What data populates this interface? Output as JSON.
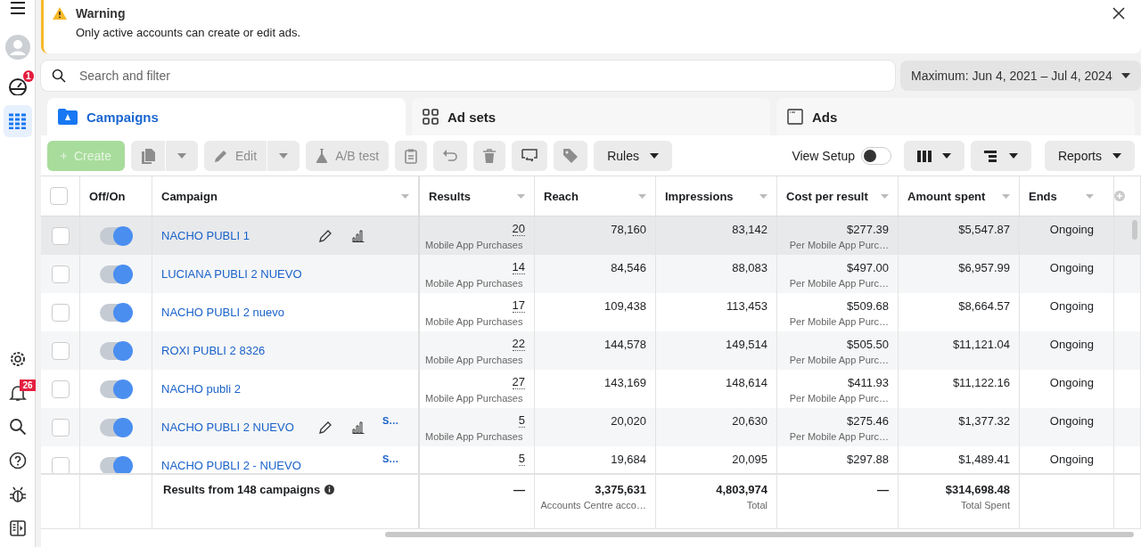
{
  "sidebar": {
    "items": [
      {
        "kind": "menu",
        "selected": false
      },
      {
        "kind": "profile",
        "selected": false
      },
      {
        "kind": "gauge",
        "selected": false,
        "badge": "1"
      },
      {
        "kind": "table",
        "selected": true
      }
    ],
    "bottom_items": [
      {
        "kind": "settings",
        "selected": false
      },
      {
        "kind": "bell",
        "selected": false,
        "badge": "26"
      },
      {
        "kind": "search",
        "selected": false
      },
      {
        "kind": "help",
        "selected": false
      },
      {
        "kind": "bug",
        "selected": false
      },
      {
        "kind": "panel",
        "selected": false
      }
    ]
  },
  "warning": {
    "title": "Warning",
    "message": "Only active accounts can create or edit ads."
  },
  "search": {
    "placeholder": "Search and filter"
  },
  "date_range": {
    "label": "Maximum: Jun 4, 2021 – Jul 4, 2024"
  },
  "tabs": [
    {
      "kind": "campaigns",
      "label": "Campaigns",
      "selected": true
    },
    {
      "kind": "adsets",
      "label": "Ad sets",
      "selected": false
    },
    {
      "kind": "ads",
      "label": "Ads",
      "selected": false
    }
  ],
  "toolbar": {
    "left": [
      {
        "kind": "create",
        "label": "Create",
        "disabled": true
      },
      {
        "kind": "duplicate",
        "disabled": true
      },
      {
        "kind": "edit",
        "label": "Edit",
        "disabled": true
      },
      {
        "kind": "abtest",
        "label": "A/B test",
        "disabled": true
      },
      {
        "kind": "clipboard",
        "disabled": true
      },
      {
        "kind": "undo",
        "disabled": true
      },
      {
        "kind": "delete",
        "disabled": true
      },
      {
        "kind": "swap",
        "disabled": false
      },
      {
        "kind": "tag",
        "disabled": true
      },
      {
        "kind": "menu",
        "label": "Rules",
        "disabled": false
      }
    ],
    "view_setup": {
      "label": "View Setup",
      "on": false
    },
    "right": [
      {
        "kind": "columns",
        "disabled": false
      },
      {
        "kind": "breakdown",
        "disabled": false
      },
      {
        "kind": "menu",
        "label": "Reports",
        "disabled": false
      }
    ]
  },
  "table": {
    "select_all_checked": false,
    "columns": [
      "Off/On",
      "Campaign",
      "Results",
      "Reach",
      "Impressions",
      "Cost per result",
      "Amount spent",
      "Ends"
    ],
    "rows": [
      {
        "selected": true,
        "checked": false,
        "on": true,
        "campaign": "NACHO PUBLI 1",
        "actions_shown": true,
        "results": "20",
        "results_label": "Mobile App Purchases",
        "reach": "78,160",
        "impressions": "83,142",
        "cost": "$277.39",
        "cost_label": "Per Mobile App Purc…",
        "amount": "$5,547.87",
        "ends": "Ongoing"
      },
      {
        "selected": false,
        "checked": false,
        "on": true,
        "campaign": "LUCIANA PUBLI 2 NUEVO",
        "actions_shown": false,
        "results": "14",
        "results_label": "Mobile App Purchases",
        "reach": "84,546",
        "impressions": "88,083",
        "cost": "$497.00",
        "cost_label": "Per Mobile App Purc…",
        "amount": "$6,957.99",
        "ends": "Ongoing"
      },
      {
        "selected": false,
        "checked": false,
        "on": true,
        "campaign": "NACHO PUBLI 2 nuevo",
        "actions_shown": false,
        "results": "17",
        "results_label": "Mobile App Purchases",
        "reach": "109,438",
        "impressions": "113,453",
        "cost": "$509.68",
        "cost_label": "Per Mobile App Purc…",
        "amount": "$8,664.57",
        "ends": "Ongoing"
      },
      {
        "selected": false,
        "checked": false,
        "on": true,
        "campaign": "ROXI PUBLI 2 8326",
        "actions_shown": false,
        "results": "22",
        "results_label": "Mobile App Purchases",
        "reach": "144,578",
        "impressions": "149,514",
        "cost": "$505.50",
        "cost_label": "Per Mobile App Purc…",
        "amount": "$11,121.04",
        "ends": "Ongoing"
      },
      {
        "selected": false,
        "checked": false,
        "on": true,
        "campaign": "NACHO publi 2",
        "actions_shown": false,
        "results": "27",
        "results_label": "Mobile App Purchases",
        "reach": "143,169",
        "impressions": "148,614",
        "cost": "$411.93",
        "cost_label": "Per Mobile App Purc…",
        "amount": "$11,122.16",
        "ends": "Ongoing"
      },
      {
        "selected": false,
        "checked": false,
        "on": true,
        "campaign": "NACHO PUBLI 2 NUEVO",
        "actions_shown": true,
        "tag": "S…",
        "results": "5",
        "results_label": "Mobile App Purchases",
        "reach": "20,020",
        "impressions": "20,630",
        "cost": "$275.46",
        "cost_label": "Per Mobile App Purc…",
        "amount": "$1,377.32",
        "ends": "Ongoing"
      },
      {
        "selected": false,
        "checked": false,
        "on": true,
        "campaign": "NACHO PUBLI 2 - NUEVO",
        "actions_shown": false,
        "tag": "S…",
        "results": "5",
        "reach": "19,684",
        "impressions": "20,095",
        "cost": "$297.88",
        "amount": "$1,489.41",
        "ends": "Ongoing"
      }
    ],
    "summary": {
      "label": "Results from 148 campaigns",
      "results": "—",
      "reach": "3,375,631",
      "reach_label": "Accounts Centre acco…",
      "impressions": "4,803,974",
      "impressions_label": "Total",
      "cost": "—",
      "amount": "$314,698.48",
      "amount_label": "Total Spent"
    }
  }
}
